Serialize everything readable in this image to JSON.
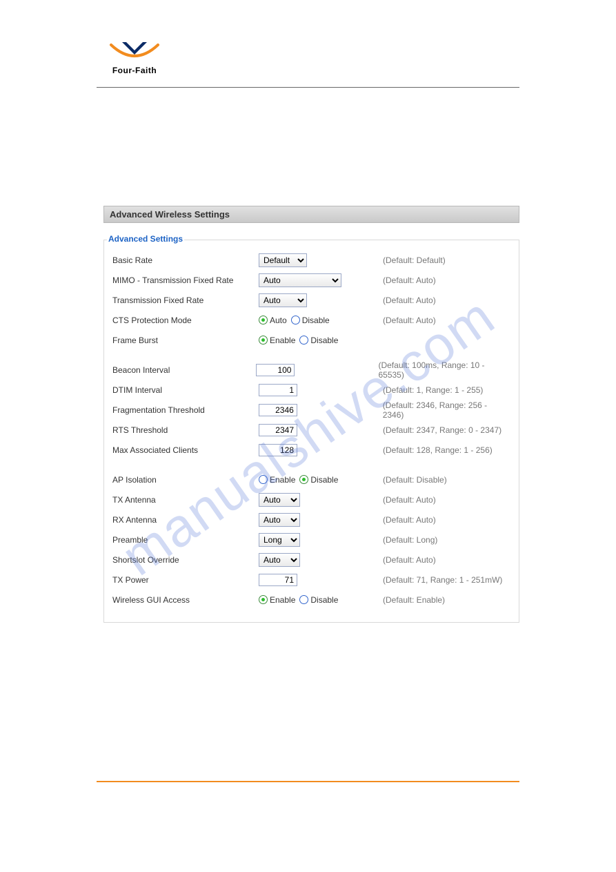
{
  "brand": {
    "name": "Four-Faith"
  },
  "watermark": "manualshive.com",
  "panel": {
    "title": "Advanced Wireless Settings",
    "legend": "Advanced Settings"
  },
  "labels": {
    "enable": "Enable",
    "disable": "Disable",
    "auto": "Auto"
  },
  "rows": {
    "basicRate": {
      "label": "Basic Rate",
      "value": "Default",
      "hint": "(Default: Default)"
    },
    "mimoRate": {
      "label": "MIMO - Transmission Fixed Rate",
      "value": "Auto",
      "hint": "(Default: Auto)"
    },
    "txFixedRate": {
      "label": "Transmission Fixed Rate",
      "value": "Auto",
      "hint": "(Default: Auto)"
    },
    "cts": {
      "label": "CTS Protection Mode",
      "hint": "(Default: Auto)"
    },
    "frameBurst": {
      "label": "Frame Burst"
    },
    "beacon": {
      "label": "Beacon Interval",
      "value": "100",
      "hint": "(Default: 100ms, Range: 10 - 65535)"
    },
    "dtim": {
      "label": "DTIM Interval",
      "value": "1",
      "hint": "(Default: 1, Range: 1 - 255)"
    },
    "frag": {
      "label": "Fragmentation Threshold",
      "value": "2346",
      "hint": "(Default: 2346, Range: 256 - 2346)"
    },
    "rts": {
      "label": "RTS Threshold",
      "value": "2347",
      "hint": "(Default: 2347, Range: 0 - 2347)"
    },
    "maxClients": {
      "label": "Max Associated Clients",
      "value": "128",
      "hint": "(Default: 128, Range: 1 - 256)"
    },
    "apIsolation": {
      "label": "AP Isolation",
      "hint": "(Default: Disable)"
    },
    "txAnt": {
      "label": "TX Antenna",
      "value": "Auto",
      "hint": "(Default: Auto)"
    },
    "rxAnt": {
      "label": "RX Antenna",
      "value": "Auto",
      "hint": "(Default: Auto)"
    },
    "preamble": {
      "label": "Preamble",
      "value": "Long",
      "hint": "(Default: Long)"
    },
    "shortslot": {
      "label": "Shortslot Override",
      "value": "Auto",
      "hint": "(Default: Auto)"
    },
    "txPower": {
      "label": "TX Power",
      "value": "71",
      "hint": "(Default: 71, Range: 1 - 251mW)"
    },
    "guiAccess": {
      "label": "Wireless GUI Access",
      "hint": "(Default: Enable)"
    }
  }
}
